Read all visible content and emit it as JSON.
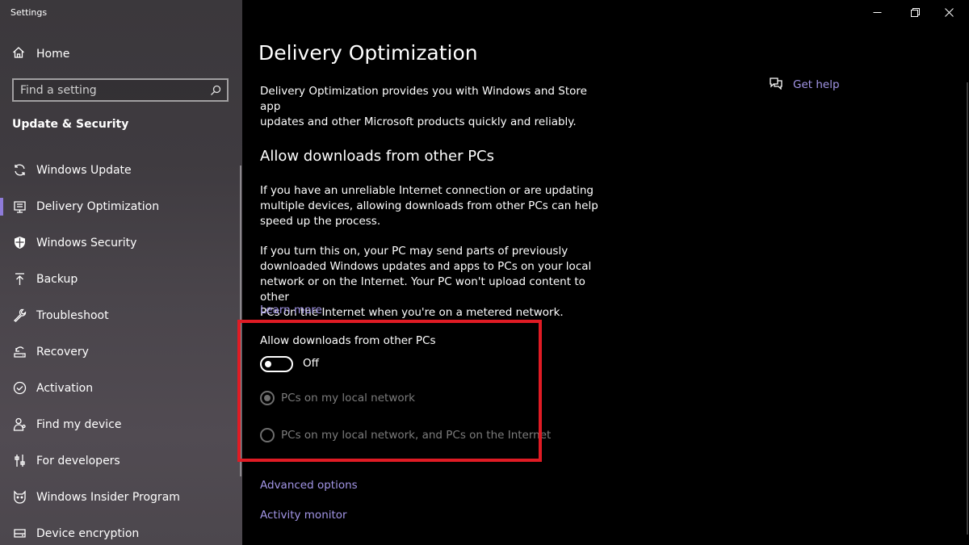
{
  "window": {
    "title": "Settings",
    "controls": [
      "minimize",
      "restore",
      "close"
    ]
  },
  "sidebar": {
    "home_label": "Home",
    "search_placeholder": "Find a setting",
    "section_title": "Update & Security",
    "items": [
      {
        "label": "Windows Update",
        "icon": "sync-icon",
        "active": false
      },
      {
        "label": "Delivery Optimization",
        "icon": "delivery-icon",
        "active": true
      },
      {
        "label": "Windows Security",
        "icon": "shield-icon",
        "active": false
      },
      {
        "label": "Backup",
        "icon": "upload-icon",
        "active": false
      },
      {
        "label": "Troubleshoot",
        "icon": "wrench-icon",
        "active": false
      },
      {
        "label": "Recovery",
        "icon": "recovery-icon",
        "active": false
      },
      {
        "label": "Activation",
        "icon": "check-circle-icon",
        "active": false
      },
      {
        "label": "Find my device",
        "icon": "person-location-icon",
        "active": false
      },
      {
        "label": "For developers",
        "icon": "sliders-icon",
        "active": false
      },
      {
        "label": "Windows Insider Program",
        "icon": "insider-cat-icon",
        "active": false
      },
      {
        "label": "Device encryption",
        "icon": "drive-icon",
        "active": false
      }
    ]
  },
  "main": {
    "title": "Delivery Optimization",
    "intro_line1": "Delivery Optimization provides you with Windows and Store app",
    "intro_line2": "updates and other Microsoft products quickly and reliably.",
    "section_heading": "Allow downloads from other PCs",
    "para1_line1": "If you have an unreliable Internet connection or are updating",
    "para1_line2": "multiple devices, allowing downloads from other PCs can help",
    "para1_line3": "speed up the process.",
    "para2_line1": "If you turn this on, your PC may send parts of previously",
    "para2_line2": "downloaded Windows updates and apps to PCs on your local",
    "para2_line3": "network or on the Internet. Your PC won't upload content to other",
    "para2_line4": "PCs on the Internet when you're on a metered network.",
    "learn_more": "Learn more",
    "toggle_label": "Allow downloads from other PCs",
    "toggle_state": "Off",
    "toggle_on": false,
    "radio_options": [
      {
        "label": "PCs on my local network",
        "selected": true,
        "enabled": false
      },
      {
        "label": "PCs on my local network, and PCs on the Internet",
        "selected": false,
        "enabled": false
      }
    ],
    "advanced_options": "Advanced options",
    "activity_monitor": "Activity monitor",
    "get_help": "Get help"
  },
  "colors": {
    "accent": "#a295e6",
    "highlight_box": "#e01b24",
    "background": "#000000"
  }
}
